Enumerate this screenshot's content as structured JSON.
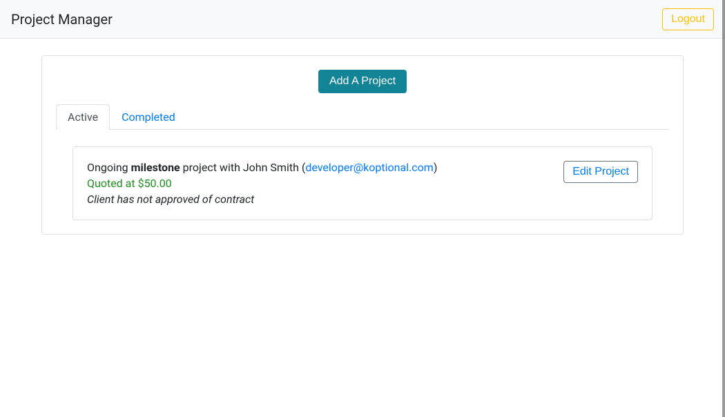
{
  "navbar": {
    "brand": "Project Manager",
    "logout_label": "Logout"
  },
  "main": {
    "add_button_label": "Add A Project",
    "tabs": {
      "active": "Active",
      "completed": "Completed"
    },
    "project": {
      "prefix": "Ongoing ",
      "type": "milestone",
      "with": " project with John Smith (",
      "email": "developer@koptional.com",
      "suffix": ")",
      "quote": "Quoted at $50.00",
      "status": "Client has not approved of contract",
      "edit_label": "Edit Project"
    }
  }
}
